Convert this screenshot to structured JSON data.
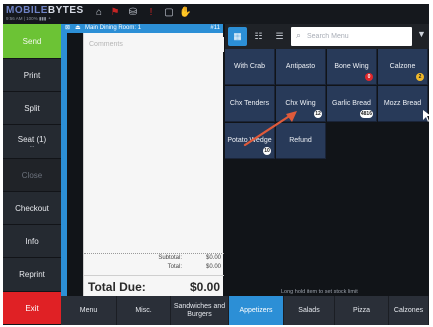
{
  "brand": {
    "part1": "MOBILE",
    "part2": "BYTES"
  },
  "status_bar": {
    "text": "9:56 AM  |  100%  ▮▮▮  ⚬"
  },
  "top_icons": [
    {
      "name": "home-icon",
      "glyph": "⌂"
    },
    {
      "name": "flag-icon",
      "glyph": "⚑"
    },
    {
      "name": "bag-icon",
      "glyph": "⛁"
    },
    {
      "name": "alert-icon",
      "glyph": "!"
    },
    {
      "name": "chat-icon",
      "glyph": "▢"
    },
    {
      "name": "hand-icon",
      "glyph": "✋"
    }
  ],
  "left_buttons": [
    {
      "label": "Send"
    },
    {
      "label": "Print"
    },
    {
      "label": "Split"
    },
    {
      "label": "Seat (1)",
      "sub": "..."
    },
    {
      "label": "Close"
    },
    {
      "label": "Checkout"
    },
    {
      "label": "Info"
    },
    {
      "label": "Reprint"
    },
    {
      "label": "Exit"
    }
  ],
  "order": {
    "room": "Main Dining Room: 1",
    "number": "#11",
    "comments_placeholder": "Comments",
    "subtotal_label": "Subtotal:",
    "subtotal_value": "$0.00",
    "total_label": "Total:",
    "total_value": "$0.00",
    "total_due_label": "Total Due:",
    "total_due_value": "$0.00"
  },
  "search": {
    "placeholder": "Search Menu"
  },
  "menu_items": [
    {
      "label": "With Crab"
    },
    {
      "label": "Antipasto"
    },
    {
      "label": "Bone Wing",
      "badge": "0",
      "badge_color": "red"
    },
    {
      "label": "Calzone",
      "badge": "2",
      "badge_color": "yellow"
    },
    {
      "label": "Chx Tenders"
    },
    {
      "label": "Chx Wing",
      "badge": "12",
      "badge_color": "white"
    },
    {
      "label": "Garlic Bread",
      "badge": "4816",
      "badge_color": "white"
    },
    {
      "label": "Mozz Bread"
    },
    {
      "label": "Potato Wedge",
      "badge": "10",
      "badge_color": "white"
    },
    {
      "label": "Refund"
    }
  ],
  "hint": "Long hold item to set stock limit",
  "categories": [
    {
      "label": "Menu"
    },
    {
      "label": "Misc."
    },
    {
      "label": "Sandwiches and Burgers"
    },
    {
      "label": "Appetizers",
      "active": true
    },
    {
      "label": "Salads"
    },
    {
      "label": "Pizza"
    },
    {
      "label": "Calzones"
    }
  ],
  "colors": {
    "accent": "#2c8fd6",
    "send": "#6cc335",
    "exit": "#e02125",
    "tile": "#283a59",
    "arrow": "#e05a3a"
  }
}
